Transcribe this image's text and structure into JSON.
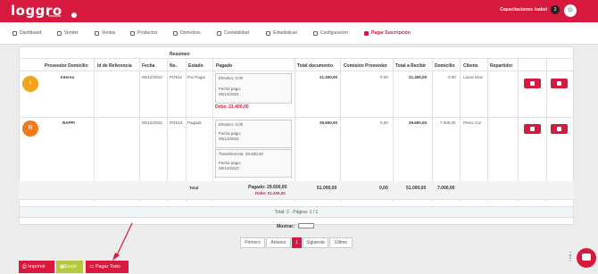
{
  "brand": {
    "name": "loggro",
    "sub": "restobar"
  },
  "topbar": {
    "capacitaciones": "Capacitaciones -",
    "user": "Isabel",
    "badge": "3"
  },
  "nav": [
    {
      "label": "Dashboard"
    },
    {
      "label": "Vender"
    },
    {
      "label": "Ventas"
    },
    {
      "label": "Productos"
    },
    {
      "label": "Domicilios"
    },
    {
      "label": "Contabilidad"
    },
    {
      "label": "Estadísticas"
    },
    {
      "label": "Configuración"
    },
    {
      "label": "Pagar Suscripción"
    }
  ],
  "table": {
    "resumen": "Resumen",
    "headers": [
      "Proveedor Domicilio",
      "Id de Referencia",
      "Fecha",
      "No.",
      "Estado",
      "Pagado",
      "Total documento",
      "Comisión Proveedor",
      "Total a Recibir",
      "Domicilio",
      "Cliente",
      "Repartidor"
    ],
    "rows": [
      {
        "avatar": "I",
        "provider": "Interno",
        "ref": "",
        "date": "06/12/2023",
        "no": "POS11",
        "status": "Por Pagar",
        "payments": [
          "Efectivo: 0,00",
          "Fecha pago:",
          "06/12/2023"
        ],
        "debe": "Debe: 21.400,00",
        "total": "21.400,00",
        "commission": "0,00",
        "receive": "21.400,00",
        "delivery": "0,00",
        "client": "Laura Díaz"
      },
      {
        "avatar": "R",
        "provider": "RAPPI",
        "ref": "",
        "date": "06/12/2023",
        "no": "POS16",
        "status": "Pagada",
        "payments": [
          "Efectivo: 0,00",
          "Fecha pago:",
          "06/12/2023",
          "Transferencia: 29.600,00",
          "Fecha pago:",
          "06/12/2023"
        ],
        "total": "29.600,00",
        "commission": "0,00",
        "receive": "29.600,00",
        "delivery": "7.000,00",
        "client": "Perez Cvt"
      }
    ],
    "totals": {
      "label": "Total",
      "paid": "Pagado: 29.600,00",
      "debe": "Debe: 21.400,00",
      "total": "51.000,00",
      "commission": "0,00",
      "receive": "51.000,00",
      "delivery": "7.000,00"
    }
  },
  "footer": {
    "summary": "Total: 2 - Página: 1 / 1",
    "mostrar": "Mostrar:"
  },
  "pagination": {
    "first": "Primero",
    "prev": "Anterior",
    "current": "1",
    "next": "Siguiente",
    "last": "Último"
  },
  "buttons": {
    "print": "Imprimir",
    "excel": "Excel",
    "pay_all": "Pagar Todo"
  },
  "colors": {
    "brand": "#d6193d",
    "excel": "#b8c740"
  }
}
